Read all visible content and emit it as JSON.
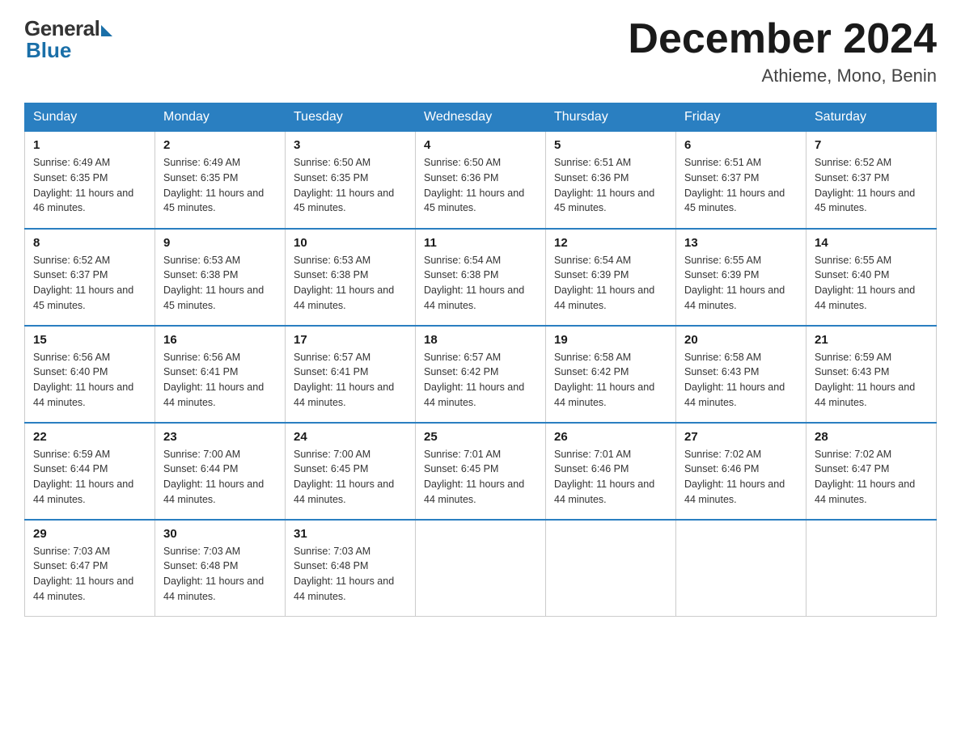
{
  "logo": {
    "general": "General",
    "blue": "Blue"
  },
  "title": "December 2024",
  "location": "Athieme, Mono, Benin",
  "days_of_week": [
    "Sunday",
    "Monday",
    "Tuesday",
    "Wednesday",
    "Thursday",
    "Friday",
    "Saturday"
  ],
  "weeks": [
    [
      {
        "day": "1",
        "sunrise": "6:49 AM",
        "sunset": "6:35 PM",
        "daylight": "11 hours and 46 minutes."
      },
      {
        "day": "2",
        "sunrise": "6:49 AM",
        "sunset": "6:35 PM",
        "daylight": "11 hours and 45 minutes."
      },
      {
        "day": "3",
        "sunrise": "6:50 AM",
        "sunset": "6:35 PM",
        "daylight": "11 hours and 45 minutes."
      },
      {
        "day": "4",
        "sunrise": "6:50 AM",
        "sunset": "6:36 PM",
        "daylight": "11 hours and 45 minutes."
      },
      {
        "day": "5",
        "sunrise": "6:51 AM",
        "sunset": "6:36 PM",
        "daylight": "11 hours and 45 minutes."
      },
      {
        "day": "6",
        "sunrise": "6:51 AM",
        "sunset": "6:37 PM",
        "daylight": "11 hours and 45 minutes."
      },
      {
        "day": "7",
        "sunrise": "6:52 AM",
        "sunset": "6:37 PM",
        "daylight": "11 hours and 45 minutes."
      }
    ],
    [
      {
        "day": "8",
        "sunrise": "6:52 AM",
        "sunset": "6:37 PM",
        "daylight": "11 hours and 45 minutes."
      },
      {
        "day": "9",
        "sunrise": "6:53 AM",
        "sunset": "6:38 PM",
        "daylight": "11 hours and 45 minutes."
      },
      {
        "day": "10",
        "sunrise": "6:53 AM",
        "sunset": "6:38 PM",
        "daylight": "11 hours and 44 minutes."
      },
      {
        "day": "11",
        "sunrise": "6:54 AM",
        "sunset": "6:38 PM",
        "daylight": "11 hours and 44 minutes."
      },
      {
        "day": "12",
        "sunrise": "6:54 AM",
        "sunset": "6:39 PM",
        "daylight": "11 hours and 44 minutes."
      },
      {
        "day": "13",
        "sunrise": "6:55 AM",
        "sunset": "6:39 PM",
        "daylight": "11 hours and 44 minutes."
      },
      {
        "day": "14",
        "sunrise": "6:55 AM",
        "sunset": "6:40 PM",
        "daylight": "11 hours and 44 minutes."
      }
    ],
    [
      {
        "day": "15",
        "sunrise": "6:56 AM",
        "sunset": "6:40 PM",
        "daylight": "11 hours and 44 minutes."
      },
      {
        "day": "16",
        "sunrise": "6:56 AM",
        "sunset": "6:41 PM",
        "daylight": "11 hours and 44 minutes."
      },
      {
        "day": "17",
        "sunrise": "6:57 AM",
        "sunset": "6:41 PM",
        "daylight": "11 hours and 44 minutes."
      },
      {
        "day": "18",
        "sunrise": "6:57 AM",
        "sunset": "6:42 PM",
        "daylight": "11 hours and 44 minutes."
      },
      {
        "day": "19",
        "sunrise": "6:58 AM",
        "sunset": "6:42 PM",
        "daylight": "11 hours and 44 minutes."
      },
      {
        "day": "20",
        "sunrise": "6:58 AM",
        "sunset": "6:43 PM",
        "daylight": "11 hours and 44 minutes."
      },
      {
        "day": "21",
        "sunrise": "6:59 AM",
        "sunset": "6:43 PM",
        "daylight": "11 hours and 44 minutes."
      }
    ],
    [
      {
        "day": "22",
        "sunrise": "6:59 AM",
        "sunset": "6:44 PM",
        "daylight": "11 hours and 44 minutes."
      },
      {
        "day": "23",
        "sunrise": "7:00 AM",
        "sunset": "6:44 PM",
        "daylight": "11 hours and 44 minutes."
      },
      {
        "day": "24",
        "sunrise": "7:00 AM",
        "sunset": "6:45 PM",
        "daylight": "11 hours and 44 minutes."
      },
      {
        "day": "25",
        "sunrise": "7:01 AM",
        "sunset": "6:45 PM",
        "daylight": "11 hours and 44 minutes."
      },
      {
        "day": "26",
        "sunrise": "7:01 AM",
        "sunset": "6:46 PM",
        "daylight": "11 hours and 44 minutes."
      },
      {
        "day": "27",
        "sunrise": "7:02 AM",
        "sunset": "6:46 PM",
        "daylight": "11 hours and 44 minutes."
      },
      {
        "day": "28",
        "sunrise": "7:02 AM",
        "sunset": "6:47 PM",
        "daylight": "11 hours and 44 minutes."
      }
    ],
    [
      {
        "day": "29",
        "sunrise": "7:03 AM",
        "sunset": "6:47 PM",
        "daylight": "11 hours and 44 minutes."
      },
      {
        "day": "30",
        "sunrise": "7:03 AM",
        "sunset": "6:48 PM",
        "daylight": "11 hours and 44 minutes."
      },
      {
        "day": "31",
        "sunrise": "7:03 AM",
        "sunset": "6:48 PM",
        "daylight": "11 hours and 44 minutes."
      },
      null,
      null,
      null,
      null
    ]
  ]
}
